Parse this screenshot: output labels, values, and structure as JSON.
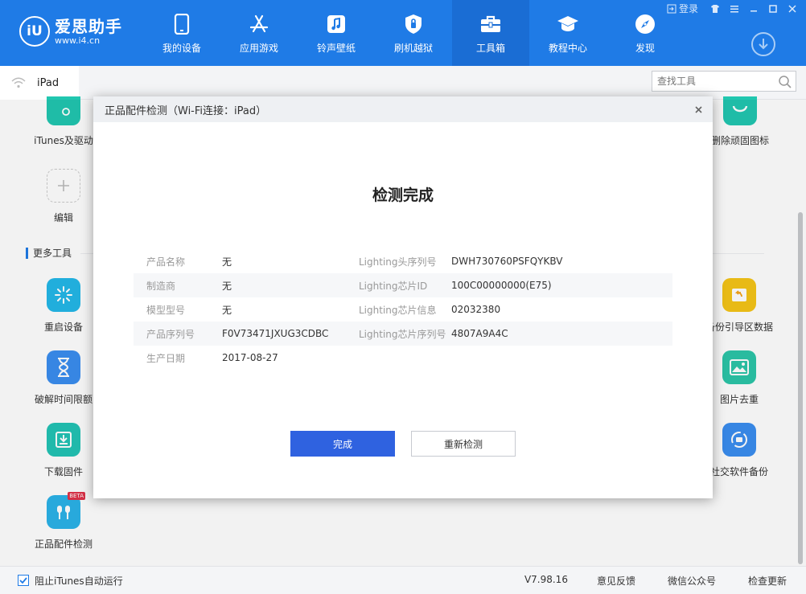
{
  "app": {
    "logo_mark": "iU",
    "logo_name": "爱思助手",
    "logo_url": "www.i4.cn"
  },
  "nav": [
    {
      "label": "我的设备",
      "icon": "phone-icon"
    },
    {
      "label": "应用游戏",
      "icon": "app-store-icon"
    },
    {
      "label": "铃声壁纸",
      "icon": "music-icon"
    },
    {
      "label": "刷机越狱",
      "icon": "shield-icon"
    },
    {
      "label": "工具箱",
      "icon": "toolbox-icon"
    },
    {
      "label": "教程中心",
      "icon": "graduation-cap-icon"
    },
    {
      "label": "发现",
      "icon": "compass-icon"
    }
  ],
  "window": {
    "login_label": "登录"
  },
  "tabbar": {
    "device_name": "iPad",
    "search_placeholder": "查找工具"
  },
  "tools": {
    "top_left": [
      "iTunes及驱动",
      "编辑"
    ],
    "top_right": [
      "删除顽固图标"
    ],
    "section_title": "更多工具",
    "left": [
      "重启设备",
      "破解时间限额",
      "下载固件",
      "正品配件检测"
    ],
    "right": [
      "备份引导区数据",
      "图片去重",
      "社交软件备份"
    ],
    "beta_badge": "BETA"
  },
  "dialog": {
    "title": "正品配件检测（Wi-Fi连接：iPad）",
    "heading": "检测完成",
    "rows": [
      {
        "l1": "产品名称",
        "v1": "无",
        "l2": "Lighting头序列号",
        "v2": "DWH730760PSFQYKBV"
      },
      {
        "l1": "制造商",
        "v1": "无",
        "l2": "Lighting芯片ID",
        "v2": "100C00000000(E75)"
      },
      {
        "l1": "模型型号",
        "v1": "无",
        "l2": "Lighting芯片信息",
        "v2": "02032380"
      },
      {
        "l1": "产品序列号",
        "v1": "F0V73471JXUG3CDBC",
        "l2": "Lighting芯片序列号",
        "v2": "4807A9A4C"
      },
      {
        "l1": "生产日期",
        "v1": "2017-08-27",
        "l2": "",
        "v2": ""
      }
    ],
    "done_button": "完成",
    "recheck_button": "重新检测"
  },
  "statusbar": {
    "itunes_checkbox_label": "阻止iTunes自动运行",
    "itunes_checked": true,
    "version": "V7.98.16",
    "feedback": "意见反馈",
    "wechat": "微信公众号",
    "check_update": "检查更新"
  },
  "colors": {
    "brand_blue": "#1f7be6",
    "primary_button": "#2f62e0"
  }
}
